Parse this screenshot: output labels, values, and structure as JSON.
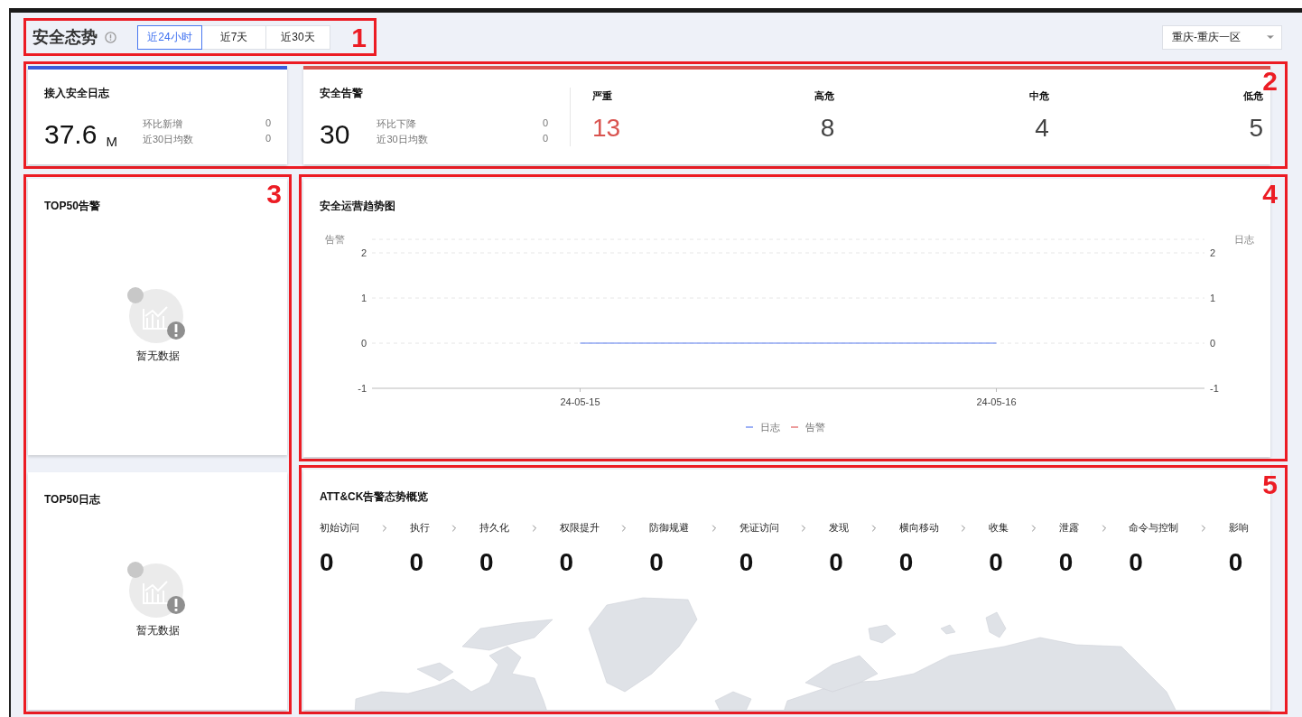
{
  "header": {
    "title": "安全态势",
    "ranges": [
      {
        "label": "近24小时",
        "selected": true
      },
      {
        "label": "近7天",
        "selected": false
      },
      {
        "label": "近30天",
        "selected": false
      }
    ],
    "region": {
      "value": "重庆-重庆一区"
    }
  },
  "log_card": {
    "title": "接入安全日志",
    "value": "37.6",
    "unit": "M",
    "rows": [
      {
        "label": "环比新增",
        "value": "0"
      },
      {
        "label": "近30日均数",
        "value": "0"
      }
    ]
  },
  "alert_card": {
    "title": "安全告警",
    "value": "30",
    "rows": [
      {
        "label": "环比下降",
        "value": "0"
      },
      {
        "label": "近30日均数",
        "value": "0"
      }
    ],
    "severities": [
      {
        "label": "严重",
        "value": "13",
        "color": "#d9534f"
      },
      {
        "label": "高危",
        "value": "8",
        "color": "#444444"
      },
      {
        "label": "中危",
        "value": "4",
        "color": "#444444"
      },
      {
        "label": "低危",
        "value": "5",
        "color": "#444444"
      }
    ]
  },
  "top_alerts": {
    "title": "TOP50告警",
    "empty_text": "暂无数据"
  },
  "top_logs": {
    "title": "TOP50日志",
    "empty_text": "暂无数据"
  },
  "trend": {
    "title": "安全运营趋势图",
    "right_axis_label": "日志",
    "right_yticks": [
      "2",
      "1",
      "0",
      "-1"
    ],
    "chart_data": {
      "type": "line",
      "ylabel": "告警",
      "categories": [
        "24-05-15",
        "24-05-16"
      ],
      "series": [
        {
          "name": "日志",
          "color": "#5b7cf0",
          "values": [
            0,
            0
          ]
        },
        {
          "name": "告警",
          "color": "#e05a5a",
          "values": [
            null,
            null
          ]
        }
      ],
      "ylim": [
        -1,
        2
      ],
      "yticks": [
        -1,
        0,
        1,
        2
      ]
    }
  },
  "attack": {
    "title": "ATT&CK告警态势概览",
    "tactics": [
      {
        "label": "初始访问",
        "count": "0"
      },
      {
        "label": "执行",
        "count": "0"
      },
      {
        "label": "持久化",
        "count": "0"
      },
      {
        "label": "权限提升",
        "count": "0"
      },
      {
        "label": "防御规避",
        "count": "0"
      },
      {
        "label": "凭证访问",
        "count": "0"
      },
      {
        "label": "发现",
        "count": "0"
      },
      {
        "label": "横向移动",
        "count": "0"
      },
      {
        "label": "收集",
        "count": "0"
      },
      {
        "label": "泄露",
        "count": "0"
      },
      {
        "label": "命令与控制",
        "count": "0"
      },
      {
        "label": "影响",
        "count": "0"
      }
    ]
  },
  "annotations": [
    "1",
    "2",
    "3",
    "4",
    "5"
  ]
}
